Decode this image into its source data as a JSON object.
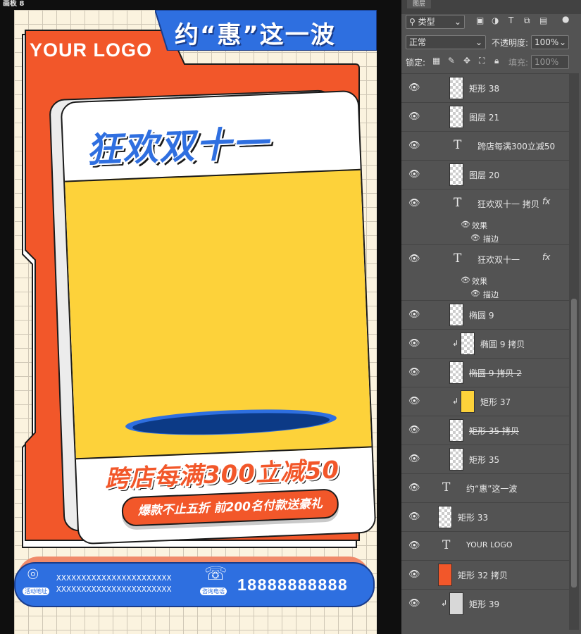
{
  "artboard": {
    "label": "画板 8"
  },
  "poster": {
    "slogan": "约“惠”这一波",
    "logo": "YOUR LOGO",
    "title": "狂欢双十一",
    "promo": "跨店每满300立减50",
    "pill": "爆款不止五折  前200名付款送豪礼",
    "footer": {
      "address_caption": "活动地址",
      "address_line1": "XXXXXXXXXXXXXXXXXXXXXXX",
      "address_line2": "XXXXXXXXXXXXXXXXXXXXXXX",
      "phone_caption": "咨询电话",
      "phone": "18888888888"
    },
    "colors": {
      "orange": "#f2572a",
      "blue": "#2e6fe0",
      "yellow": "#fdd23a",
      "cream": "#fbf3df"
    }
  },
  "layers_panel": {
    "tab": "图层",
    "filter": "类型",
    "blend_mode": "正常",
    "opacity_label": "不透明度:",
    "opacity_value": "100%",
    "lock_label": "锁定:",
    "fill_label": "填充:",
    "fill_value": "100%",
    "effects_label": "效果",
    "stroke_label": "描边",
    "layers": [
      {
        "name": "矩形 38",
        "kind": "shape"
      },
      {
        "name": "图层 21",
        "kind": "pixel"
      },
      {
        "name": "跨店每满300立减50",
        "kind": "text"
      },
      {
        "name": "图层 20",
        "kind": "pixel"
      },
      {
        "name": "狂欢双十一 拷贝",
        "kind": "text"
      },
      {
        "name": "狂欢双十一",
        "kind": "text"
      },
      {
        "name": "椭圆 9",
        "kind": "shape"
      },
      {
        "name": "椭圆 9 拷贝",
        "kind": "shape"
      },
      {
        "name": "椭圆 9 拷贝 2",
        "kind": "shape"
      },
      {
        "name": "矩形 37",
        "kind": "shape"
      },
      {
        "name": "矩形 35 拷贝",
        "kind": "shape"
      },
      {
        "name": "矩形 35",
        "kind": "shape"
      },
      {
        "name": "约“惠”这一波",
        "kind": "text"
      },
      {
        "name": "矩形 33",
        "kind": "shape"
      },
      {
        "name": "YOUR LOGO",
        "kind": "text"
      },
      {
        "name": "矩形 32 拷贝",
        "kind": "shape"
      },
      {
        "name": "矩形 39",
        "kind": "shape"
      }
    ]
  }
}
